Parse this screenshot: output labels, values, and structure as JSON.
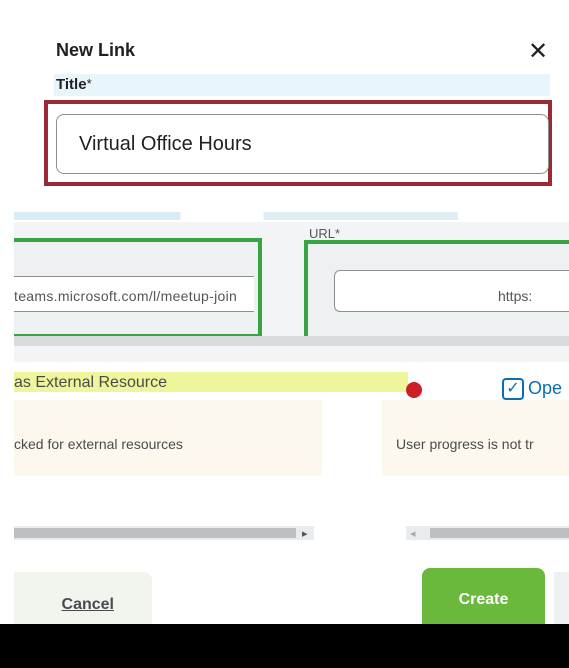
{
  "dialog": {
    "title": "New Link",
    "close_glyph": "✕"
  },
  "title_field": {
    "label": "Title",
    "required_mark": "*",
    "value": "Virtual Office Hours"
  },
  "url_field": {
    "label": "URL*",
    "value_fragment_left": "teams.microsoft.com/l/meetup-join",
    "value_fragment_right": "https:"
  },
  "options": {
    "external_label": "as External Resource",
    "external_note": "cked for external resources",
    "new_window_label": "Ope",
    "progress_note": "User progress is not tr"
  },
  "scrollbar": {
    "right_arrow": "▸",
    "left_arrow": "◂"
  },
  "buttons": {
    "cancel": "Cancel",
    "create": "Create"
  },
  "colors": {
    "highlight_border": "#9b2a36",
    "create_green": "#6ab93d",
    "url_green": "#3aa342",
    "link_blue": "#0a6fb7"
  },
  "icons": {
    "close": "close-icon",
    "check": "checkbox-icon",
    "warning": "alert-icon"
  }
}
